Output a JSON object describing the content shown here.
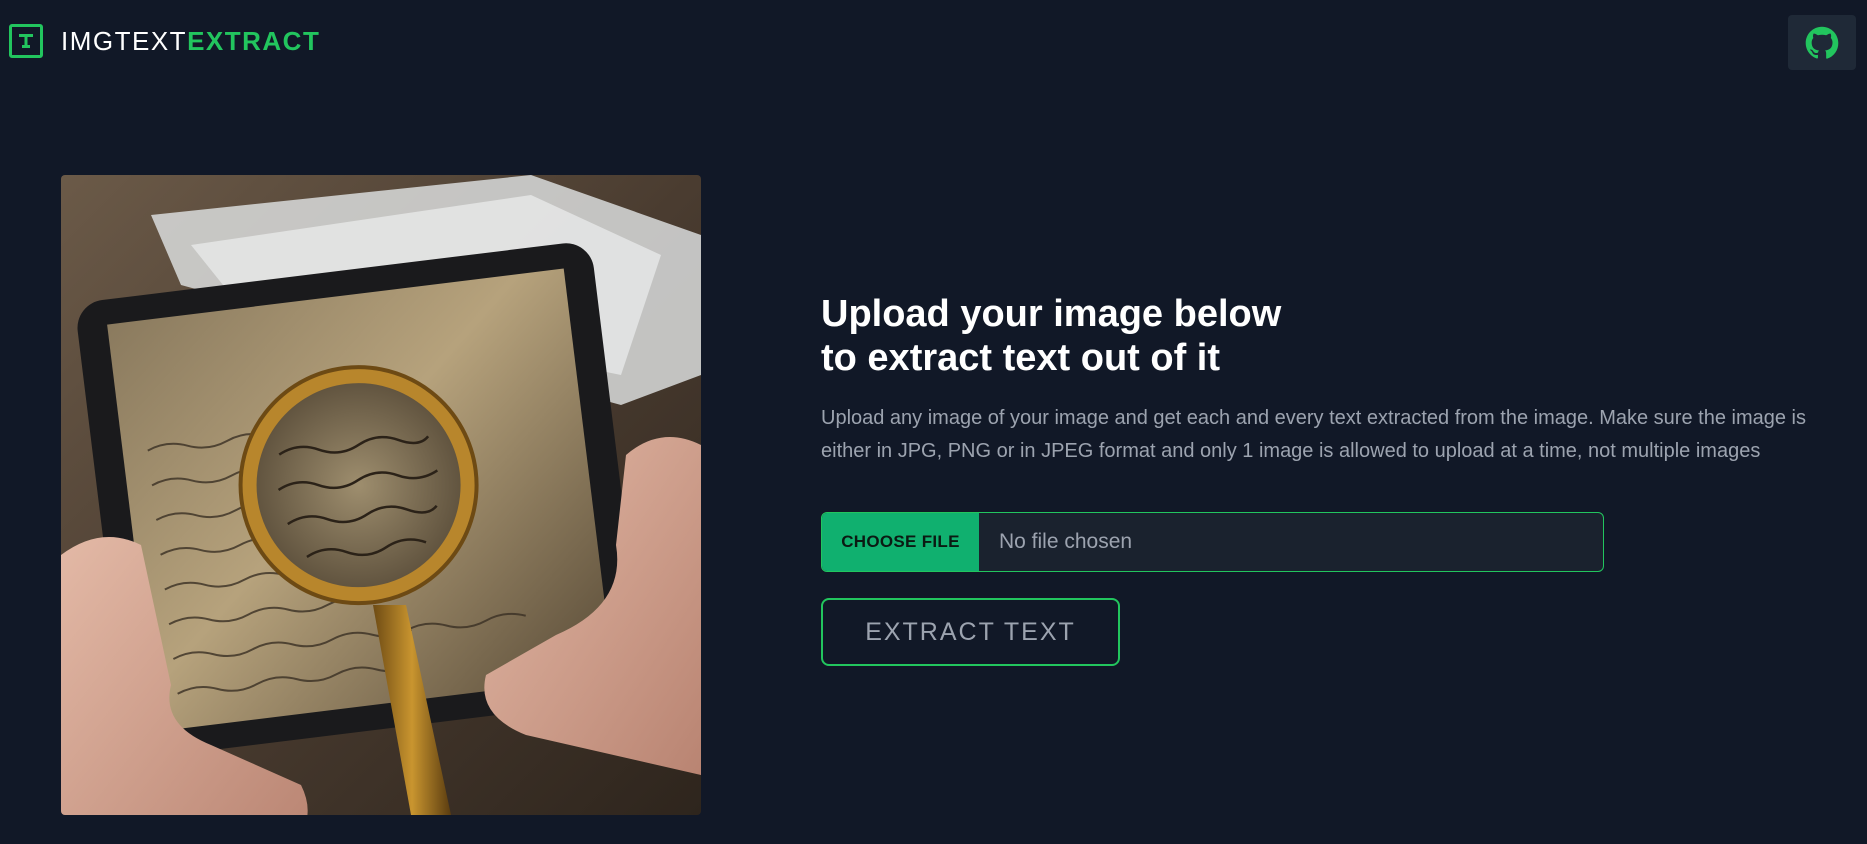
{
  "header": {
    "logo_text_a": "IMGTEXT",
    "logo_text_b": "EXTRACT",
    "logo_icon": "t-text-icon",
    "github_icon": "github-icon"
  },
  "hero": {
    "image_description": "hands holding tablet with magnifying glass over old handwritten document"
  },
  "main": {
    "title_line1": "Upload your image below",
    "title_line2": "to extract text out of it",
    "description": "Upload any image of your image and get each and every text extracted from the image. Make sure the image is either in JPG, PNG or in JPEG format and only 1 image is allowed to upload at a time, not multiple images",
    "choose_file_label": "CHOOSE FILE",
    "file_status": "No file chosen",
    "extract_label": "EXTRACT TEXT"
  },
  "colors": {
    "background": "#111827",
    "accent": "#22c55e",
    "button_fill": "#10b06f",
    "muted_text": "#9ca3af"
  }
}
